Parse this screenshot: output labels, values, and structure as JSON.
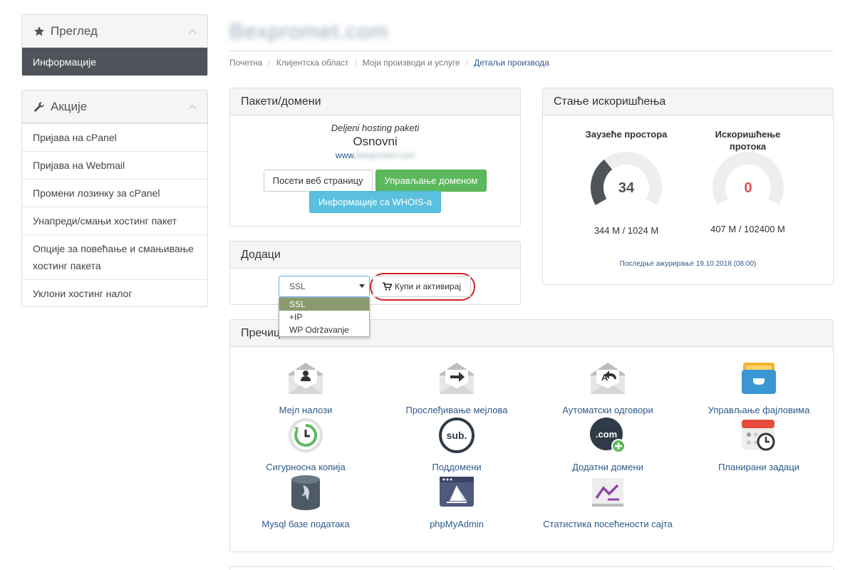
{
  "sidebar": {
    "overview": {
      "title": "Преглед",
      "items": [
        {
          "label": "Информације"
        }
      ]
    },
    "actions": {
      "title": "Акције",
      "items": [
        {
          "label": "Пријава на cPanel"
        },
        {
          "label": "Пријава на Webmail"
        },
        {
          "label": "Промени лозинку за cPanel"
        },
        {
          "label": "Унапреди/смањи хостинг пакет"
        },
        {
          "label": "Опције за повећање и смањивање хостинг пакета"
        },
        {
          "label": "Уклони хостинг налог"
        }
      ]
    }
  },
  "header": {
    "title": "Bexpromet.com",
    "breadcrumb": [
      "Почетна",
      "Клијентска област",
      "Моји производи и услуге",
      "Детаљи производа"
    ]
  },
  "package": {
    "title": "Пакети/домени",
    "type": "Deljeni hosting paketi",
    "name": "Osnovni",
    "domain_prefix": "www.",
    "domain_rest": "bexpromet.com",
    "visit_button": "Посети веб страницу",
    "manage_domain_button": "Управљање доменом",
    "whois_button": "Информације са WHOIS-a"
  },
  "usage": {
    "title": "Стање искоришћења",
    "disk": {
      "label": "Заузеће простора",
      "percent": "34",
      "percent_value": 34,
      "value": "344 M / 1024 M"
    },
    "bandwidth": {
      "label": "Искоришћење протока",
      "percent": "0",
      "percent_value": 0,
      "value": "407 M / 102400 M"
    },
    "updated": "Последње ажурирање 19.10.2018 (08:00)",
    "colors": {
      "disk_arc": "#4e5459",
      "track": "#eeeeee",
      "zero_text": "#d9534f"
    }
  },
  "addons": {
    "title": "Додаци",
    "select_value": "SSL",
    "options": [
      "SSL",
      "+IP",
      "WP Održavanje"
    ],
    "buy_button": "Купи и активирај"
  },
  "shortcuts": {
    "title": "Пречице",
    "items": [
      {
        "label": "Мејл налози",
        "icon": "email-accounts-icon"
      },
      {
        "label": "Прослеђивање мејлова",
        "icon": "email-forwarders-icon"
      },
      {
        "label": "Аутоматски одговори",
        "icon": "autoresponders-icon"
      },
      {
        "label": "Управљање фајловима",
        "icon": "file-manager-icon"
      },
      {
        "label": "Сигурносна копија",
        "icon": "backup-icon"
      },
      {
        "label": "Поддомени",
        "icon": "subdomains-icon",
        "text": "sub."
      },
      {
        "label": "Додатни домени",
        "icon": "addon-domains-icon",
        "text": ".com"
      },
      {
        "label": "Планирани задаци",
        "icon": "cron-jobs-icon"
      },
      {
        "label": "Mysql базе података",
        "icon": "mysql-databases-icon"
      },
      {
        "label": "phpMyAdmin",
        "icon": "phpmyadmin-icon"
      },
      {
        "label": "Статистика посећености сајта",
        "icon": "awstats-icon"
      }
    ]
  }
}
